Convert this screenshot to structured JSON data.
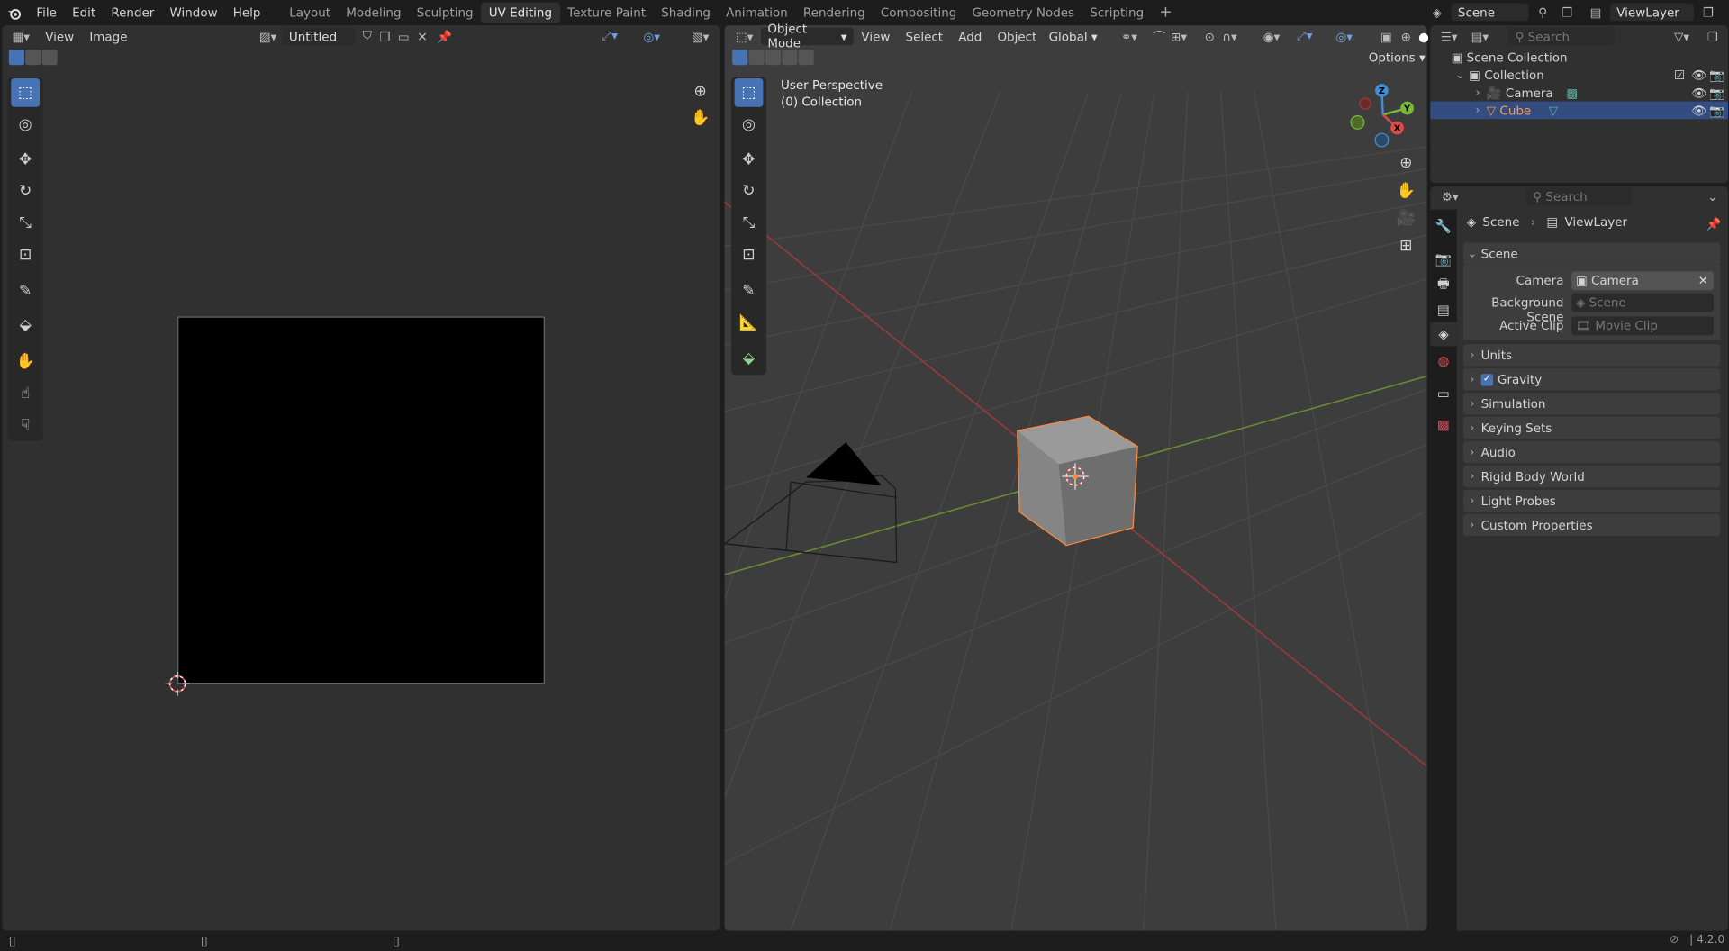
{
  "menu": {
    "file": "File",
    "edit": "Edit",
    "render": "Render",
    "window": "Window",
    "help": "Help"
  },
  "workspaces": [
    "Layout",
    "Modeling",
    "Sculpting",
    "UV Editing",
    "Texture Paint",
    "Shading",
    "Animation",
    "Rendering",
    "Compositing",
    "Geometry Nodes",
    "Scripting"
  ],
  "active_workspace": "UV Editing",
  "scene_selector": "Scene",
  "viewlayer_selector": "ViewLayer",
  "uv_editor": {
    "menu_view": "View",
    "menu_image": "Image",
    "image_name": "Untitled"
  },
  "viewport": {
    "mode": "Object Mode",
    "menu_view": "View",
    "menu_select": "Select",
    "menu_add": "Add",
    "menu_object": "Object",
    "orientation": "Global",
    "options": "Options",
    "overlay_line1": "User Perspective",
    "overlay_line2": "(0) Collection",
    "gizmo": {
      "z": "Z",
      "y": "Y",
      "x": "X"
    }
  },
  "outliner": {
    "search_placeholder": "Search",
    "scene_collection": "Scene Collection",
    "collection": "Collection",
    "camera": "Camera",
    "cube": "Cube"
  },
  "properties": {
    "search_placeholder": "Search",
    "breadcrumb_scene": "Scene",
    "breadcrumb_viewlayer": "ViewLayer",
    "panel_scene": "Scene",
    "camera_label": "Camera",
    "camera_value": "Camera",
    "bg_scene_label": "Background Scene",
    "bg_scene_placeholder": "Scene",
    "active_clip_label": "Active Clip",
    "active_clip_placeholder": "Movie Clip",
    "panels": [
      "Units",
      "Gravity",
      "Simulation",
      "Keying Sets",
      "Audio",
      "Rigid Body World",
      "Light Probes",
      "Custom Properties"
    ]
  },
  "status": {
    "version": "4.2.0"
  },
  "colors": {
    "accent": "#4772b3",
    "selection": "#ff8a3d",
    "x_axis": "#e04a4a",
    "y_axis": "#7ab83c",
    "z_axis": "#3f8fd6"
  }
}
